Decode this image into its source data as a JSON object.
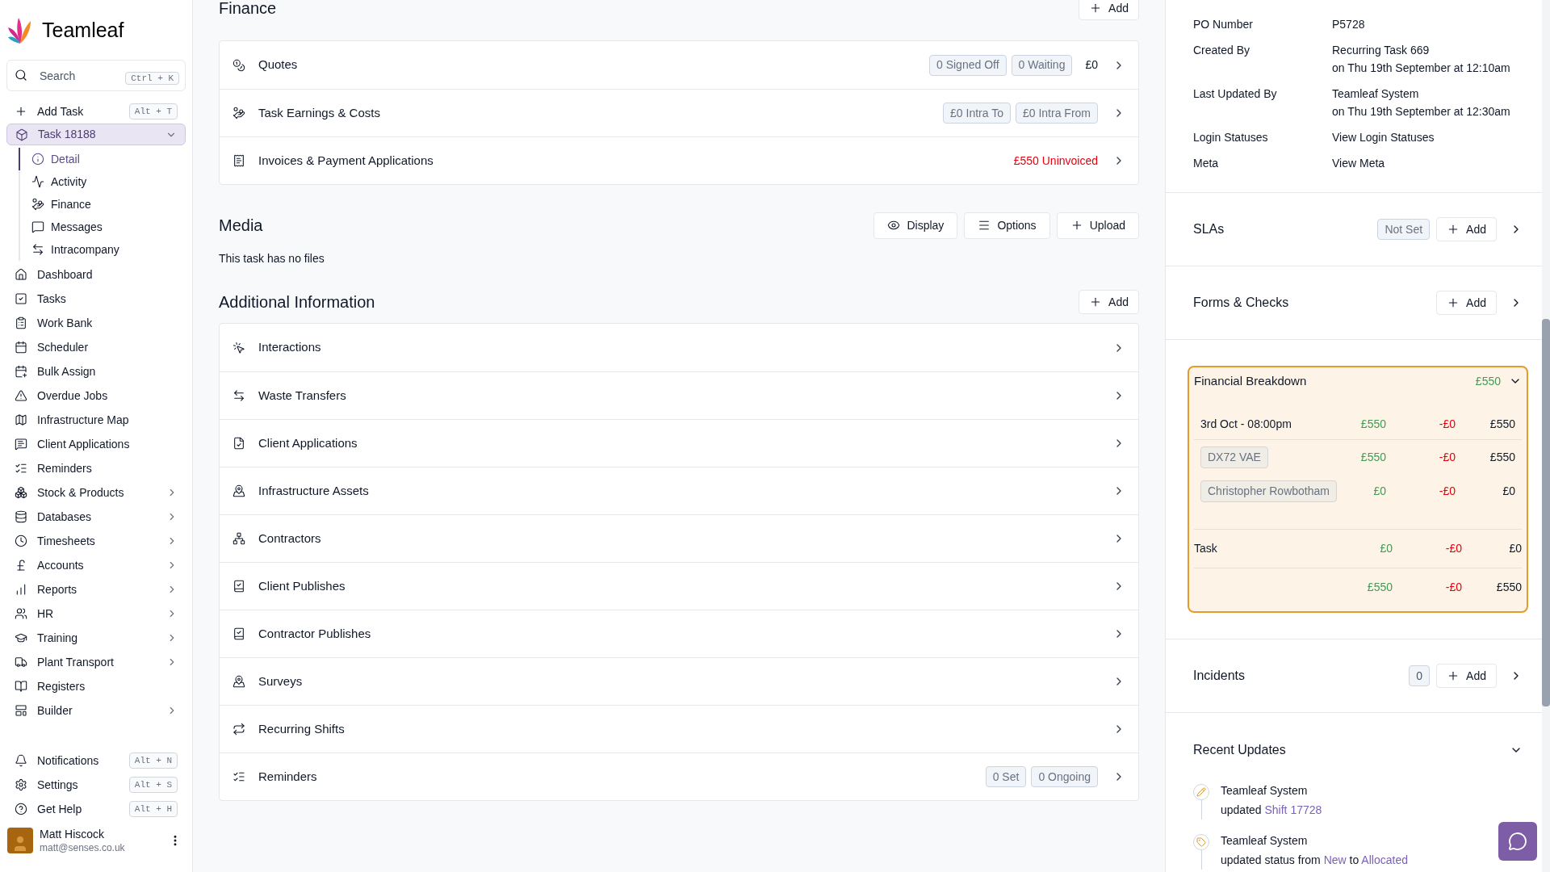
{
  "sidebar": {
    "logo": "Teamleaf",
    "search": {
      "placeholder": "Search",
      "shortcut": "Ctrl + K"
    },
    "add_task": {
      "label": "Add Task",
      "shortcut": "Alt + T"
    },
    "current_task": {
      "label": "Task 18188",
      "selected": true,
      "expanded": true,
      "children": [
        {
          "label": "Detail",
          "selected": true
        },
        {
          "label": "Activity",
          "selected": false
        },
        {
          "label": "Finance",
          "selected": false
        },
        {
          "label": "Messages",
          "selected": false
        },
        {
          "label": "Intracompany",
          "selected": false
        }
      ]
    },
    "items": [
      {
        "label": "Dashboard",
        "expandable": false
      },
      {
        "label": "Tasks",
        "expandable": false
      },
      {
        "label": "Work Bank",
        "expandable": false
      },
      {
        "label": "Scheduler",
        "expandable": false
      },
      {
        "label": "Bulk Assign",
        "expandable": false
      },
      {
        "label": "Overdue Jobs",
        "expandable": false
      },
      {
        "label": "Infrastructure Map",
        "expandable": false
      },
      {
        "label": "Client Applications",
        "expandable": false
      },
      {
        "label": "Reminders",
        "expandable": false
      },
      {
        "label": "Stock & Products",
        "expandable": true
      },
      {
        "label": "Databases",
        "expandable": true
      },
      {
        "label": "Timesheets",
        "expandable": true
      },
      {
        "label": "Accounts",
        "expandable": true
      },
      {
        "label": "Reports",
        "expandable": true
      },
      {
        "label": "HR",
        "expandable": true
      },
      {
        "label": "Training",
        "expandable": true
      },
      {
        "label": "Plant Transport",
        "expandable": true
      },
      {
        "label": "Registers",
        "expandable": false
      },
      {
        "label": "Builder",
        "expandable": true
      }
    ],
    "footer_items": [
      {
        "label": "Notifications",
        "shortcut": "Alt + N"
      },
      {
        "label": "Settings",
        "shortcut": "Alt + S"
      },
      {
        "label": "Get Help",
        "shortcut": "Alt + H"
      }
    ],
    "user": {
      "name": "Matt Hiscock",
      "email": "matt@senses.co.uk"
    }
  },
  "finance": {
    "title": "Finance",
    "add_label": "Add",
    "rows": [
      {
        "label": "Quotes",
        "badges": [
          "0 Signed Off",
          "0 Waiting"
        ],
        "amount": "£0"
      },
      {
        "label": "Task Earnings & Costs",
        "badges": [
          "£0 Intra To",
          "£0 Intra From"
        ]
      },
      {
        "label": "Invoices & Payment Applications",
        "alert": "£550 Uninvoiced"
      }
    ]
  },
  "media": {
    "title": "Media",
    "buttons": [
      "Display",
      "Options",
      "Upload"
    ],
    "empty_text": "This task has no files"
  },
  "additional_information": {
    "title": "Additional Information",
    "add_label": "Add",
    "rows": [
      {
        "label": "Interactions"
      },
      {
        "label": "Waste Transfers"
      },
      {
        "label": "Client Applications"
      },
      {
        "label": "Infrastructure Assets"
      },
      {
        "label": "Contractors"
      },
      {
        "label": "Client Publishes"
      },
      {
        "label": "Contractor Publishes"
      },
      {
        "label": "Surveys"
      },
      {
        "label": "Recurring Shifts"
      },
      {
        "label": "Reminders",
        "badges": [
          "0 Set",
          "0 Ongoing"
        ]
      }
    ]
  },
  "details": [
    {
      "label": "PO Number",
      "lines": [
        "P5728"
      ]
    },
    {
      "label": "Created By",
      "lines": [
        "Recurring Task 669",
        "on Thu 19th September at 12:10am"
      ]
    },
    {
      "label": "Last Updated By",
      "lines": [
        "Teamleaf System",
        "on Thu 19th September at 12:30am"
      ]
    },
    {
      "label": "Login Statuses",
      "lines": [
        "View Login Statuses"
      ]
    },
    {
      "label": "Meta",
      "lines": [
        "View Meta"
      ]
    }
  ],
  "slas": {
    "title": "SLAs",
    "badge": "Not Set",
    "add_label": "Add"
  },
  "forms_checks": {
    "title": "Forms & Checks",
    "add_label": "Add"
  },
  "financial_breakdown": {
    "title": "Financial Breakdown",
    "total": "£550",
    "expanded": true,
    "rows": [
      {
        "kind": "group",
        "label": "3rd Oct - 08:00pm",
        "income": "£550",
        "cost": "-£0",
        "net": "£550"
      },
      {
        "kind": "item",
        "label": "DX72 VAE",
        "income": "£550",
        "cost": "-£0",
        "net": "£550"
      },
      {
        "kind": "item",
        "label": "Christopher Rowbotham",
        "income": "£0",
        "cost": "-£0",
        "net": "£0"
      },
      {
        "kind": "task",
        "label": "Task",
        "income": "£0",
        "cost": "-£0",
        "net": "£0"
      },
      {
        "kind": "total",
        "income": "£550",
        "cost": "-£0",
        "net": "£550"
      }
    ]
  },
  "incidents": {
    "title": "Incidents",
    "count": "0",
    "add_label": "Add"
  },
  "recent_updates": {
    "title": "Recent Updates",
    "expanded": true,
    "entries": [
      {
        "kind": "edit",
        "actor": "Teamleaf System",
        "parts": [
          {
            "text": "updated",
            "link": false
          },
          {
            "text": "Shift 17728",
            "link": true
          }
        ]
      },
      {
        "kind": "status",
        "actor": "Teamleaf System",
        "parts": [
          {
            "text": "updated status from",
            "link": false
          },
          {
            "text": "New",
            "link": true
          },
          {
            "text": "to",
            "link": false
          },
          {
            "text": "Allocated",
            "link": true
          }
        ]
      }
    ]
  }
}
